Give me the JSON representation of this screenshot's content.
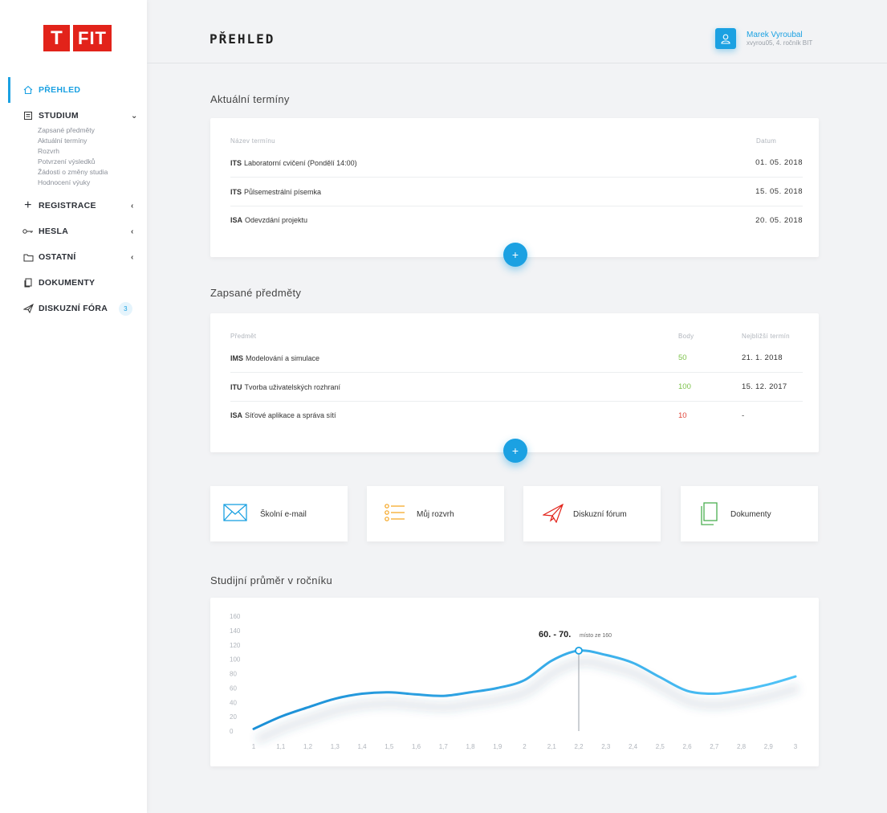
{
  "logo": {
    "t": "T",
    "fit": "FIT"
  },
  "sidebar": {
    "items": [
      {
        "label": "PŘEHLED",
        "icon": "home-icon",
        "active": true
      },
      {
        "label": "STUDIUM",
        "icon": "document-icon",
        "expanded": true,
        "subitems": [
          "Zapsané předměty",
          "Aktuální termíny",
          "Rozvrh",
          "Potvrzení výsledků",
          "Žádosti o změny studia",
          "Hodnocení výuky"
        ]
      },
      {
        "label": "REGISTRACE",
        "icon": "plus-icon"
      },
      {
        "label": "HESLA",
        "icon": "key-icon"
      },
      {
        "label": "OSTATNÍ",
        "icon": "folder-icon"
      },
      {
        "label": "DOKUMENTY",
        "icon": "documents-icon"
      },
      {
        "label": "DISKUZNÍ FÓRA",
        "icon": "paper-plane-icon",
        "badge": "3"
      }
    ]
  },
  "header": {
    "title": "PŘEHLED",
    "user_name": "Marek Vyroubal",
    "user_meta": "xvyrou05, 4. ročník BIT"
  },
  "terms": {
    "title": "Aktuální termíny",
    "col_name": "Název termínu",
    "col_date": "Datum",
    "rows": [
      {
        "code": "ITS",
        "name": "Laboratorní cvičení (Pondělí 14:00)",
        "date": "01. 05. 2018"
      },
      {
        "code": "ITS",
        "name": "Půlsemestrální písemka",
        "date": "15. 05. 2018"
      },
      {
        "code": "ISA",
        "name": " Odevzdání projektu",
        "date": "20. 05. 2018"
      }
    ]
  },
  "subjects": {
    "title": "Zapsané předměty",
    "col_subject": "Předmět",
    "col_points": "Body",
    "col_term": "Nejbližší termín",
    "rows": [
      {
        "code": "IMS",
        "name": "Modelování a simulace",
        "points": "50",
        "points_status": "ok",
        "term": "21. 1. 2018"
      },
      {
        "code": "ITU",
        "name": "Tvorba uživatelských rozhraní",
        "points": "100",
        "points_status": "ok",
        "term": "15. 12. 2017"
      },
      {
        "code": "ISA",
        "name": " Síťové aplikace a správa sítí",
        "points": "10",
        "points_status": "bad",
        "term": "-"
      }
    ]
  },
  "plus_label": "+",
  "quick_links": [
    {
      "label": "Školní e-mail",
      "icon": "mail-icon",
      "color": "#1ba1e2"
    },
    {
      "label": "Můj rozvrh",
      "icon": "list-icon",
      "color": "#f5a623"
    },
    {
      "label": "Diskuzní fórum",
      "icon": "paper-plane-icon",
      "color": "#e2231a"
    },
    {
      "label": "Dokumenty",
      "icon": "documents-icon",
      "color": "#4caf50"
    }
  ],
  "chart": {
    "title": "Studijní průměr v ročníku",
    "annotation_value": "60. - 70.",
    "annotation_note": "místo ze 160"
  },
  "chart_data": {
    "type": "line",
    "title": "Studijní průměr v ročníku",
    "xlabel": "",
    "ylabel": "",
    "x": [
      1,
      1.1,
      1.2,
      1.3,
      1.4,
      1.5,
      1.6,
      1.7,
      1.8,
      1.9,
      2,
      2.1,
      2.2,
      2.3,
      2.4,
      2.5,
      2.6,
      2.7,
      2.8,
      2.9,
      3
    ],
    "x_tick_labels": [
      "1",
      "1,1",
      "1,2",
      "1,3",
      "1,4",
      "1,5",
      "1,6",
      "1,7",
      "1,8",
      "1,9",
      "2",
      "2,1",
      "2,2",
      "2,3",
      "2,4",
      "2,5",
      "2,6",
      "2,7",
      "2,8",
      "2,9",
      "3"
    ],
    "y": [
      3,
      20,
      33,
      45,
      52,
      54,
      51,
      49,
      54,
      60,
      71,
      98,
      112,
      106,
      95,
      75,
      56,
      52,
      57,
      65,
      76
    ],
    "y_ticks": [
      0,
      20,
      40,
      60,
      80,
      100,
      120,
      140,
      160
    ],
    "ylim": [
      0,
      160
    ],
    "xlim": [
      1,
      3
    ],
    "highlight": {
      "x": 2.2,
      "y": 112
    },
    "grid": false,
    "color": "#29b6f6"
  }
}
